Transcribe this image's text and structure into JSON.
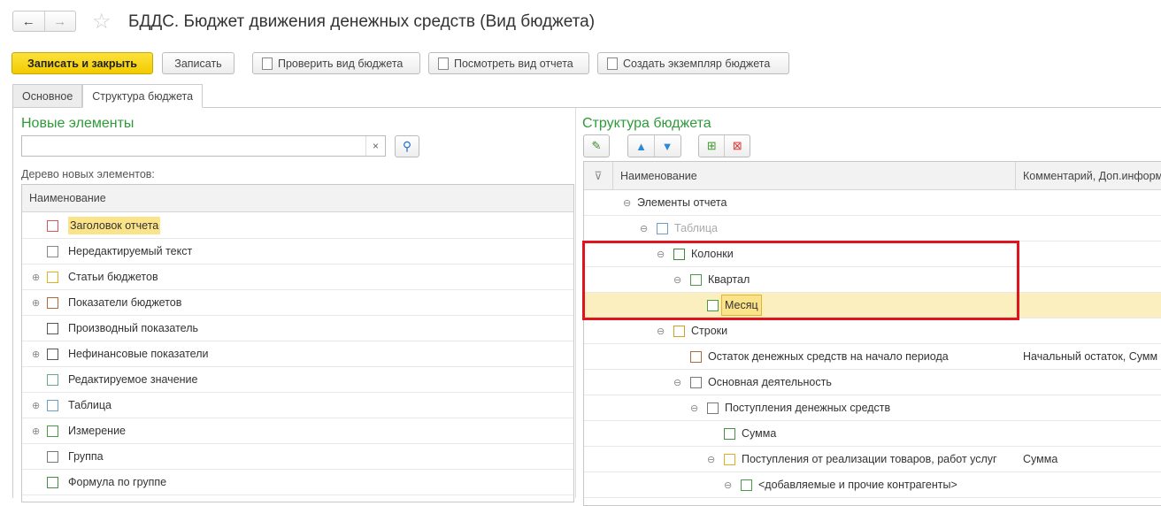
{
  "header": {
    "title": "БДДС. Бюджет движения денежных средств (Вид бюджета)",
    "back": "←",
    "forward": "→",
    "star": "☆"
  },
  "toolbar": {
    "save_close": "Записать и закрыть",
    "save": "Записать",
    "check": "Проверить вид бюджета",
    "view_report": "Посмотреть вид отчета",
    "create_instance": "Создать экземпляр бюджета"
  },
  "tabs": [
    {
      "label": "Основное"
    },
    {
      "label": "Структура бюджета"
    }
  ],
  "left": {
    "title": "Новые элементы",
    "search_value": "",
    "clear": "×",
    "search_icon": "🔍",
    "tree_label": "Дерево новых элементов:",
    "column": "Наименование",
    "items": [
      {
        "label": "Заголовок отчета",
        "icon": "header-icon",
        "expandable": false,
        "selected": true
      },
      {
        "label": "Нередактируемый текст",
        "icon": "text-icon",
        "expandable": false
      },
      {
        "label": "Статьи бюджетов",
        "icon": "coins-icon",
        "expandable": true
      },
      {
        "label": "Показатели бюджетов",
        "icon": "coins-brown-icon",
        "expandable": true
      },
      {
        "label": "Производный показатель",
        "icon": "fx-icon",
        "expandable": false
      },
      {
        "label": "Нефинансовые показатели",
        "icon": "numbers-icon",
        "expandable": true
      },
      {
        "label": "Редактируемое значение",
        "icon": "edit-value-icon",
        "expandable": false
      },
      {
        "label": "Таблица",
        "icon": "table-icon",
        "expandable": true
      },
      {
        "label": "Измерение",
        "icon": "dimension-icon",
        "expandable": true
      },
      {
        "label": "Группа",
        "icon": "group-icon",
        "expandable": false
      },
      {
        "label": "Формула по группе",
        "icon": "sum-icon",
        "expandable": false
      }
    ]
  },
  "right": {
    "title": "Структура бюджета",
    "col_name": "Наименование",
    "col_comment": "Комментарий, Доп.информ",
    "rows": [
      {
        "label": "Элементы отчета",
        "level": 0,
        "expandable": true,
        "icon": "",
        "comment": ""
      },
      {
        "label": "Таблица",
        "level": 1,
        "expandable": true,
        "icon": "table-icon",
        "comment": "",
        "muted": true
      },
      {
        "label": "Колонки",
        "level": 2,
        "expandable": true,
        "icon": "columns-icon",
        "comment": ""
      },
      {
        "label": "Квартал",
        "level": 3,
        "expandable": true,
        "icon": "dimension-icon",
        "comment": ""
      },
      {
        "label": "Месяц",
        "level": 4,
        "expandable": false,
        "icon": "dimension-icon",
        "comment": "",
        "selected": true
      },
      {
        "label": "Строки",
        "level": 2,
        "expandable": true,
        "icon": "rows-icon",
        "comment": ""
      },
      {
        "label": "Остаток денежных средств на начало периода",
        "level": 3,
        "expandable": false,
        "icon": "coins-brown-icon",
        "comment": "Начальный остаток, Сумм"
      },
      {
        "label": "Основная деятельность",
        "level": 3,
        "expandable": true,
        "icon": "group-icon",
        "comment": ""
      },
      {
        "label": "Поступления денежных средств",
        "level": 4,
        "expandable": true,
        "icon": "group-icon",
        "comment": ""
      },
      {
        "label": "Сумма",
        "level": 5,
        "expandable": false,
        "icon": "sum-icon",
        "comment": ""
      },
      {
        "label": "Поступления от реализации товаров, работ услуг",
        "level": 5,
        "expandable": true,
        "icon": "coins-icon",
        "comment": "Сумма"
      },
      {
        "label": "<добавляемые и прочие контрагенты>",
        "level": 6,
        "expandable": true,
        "icon": "dimension-icon",
        "comment": ""
      }
    ]
  },
  "colors": {
    "accent_green": "#2e9a3a",
    "primary_yellow": "#f3cb00",
    "highlight": "#e0141e",
    "selection": "#fbefc0"
  }
}
